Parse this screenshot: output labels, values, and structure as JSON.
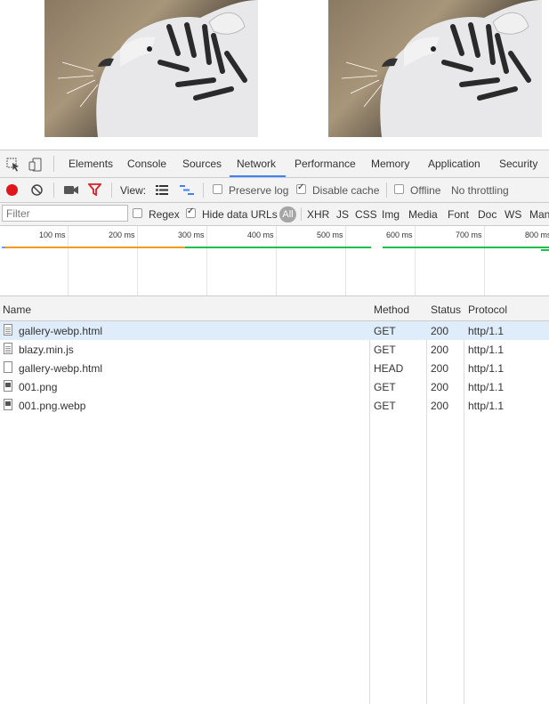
{
  "tabs": [
    "Elements",
    "Console",
    "Sources",
    "Network",
    "Performance",
    "Memory",
    "Application",
    "Security"
  ],
  "active_tab": "Network",
  "toolbar": {
    "view_label": "View:",
    "preserve_log": "Preserve log",
    "preserve_log_checked": false,
    "disable_cache": "Disable cache",
    "disable_cache_checked": true,
    "offline": "Offline",
    "offline_checked": false,
    "throttling": "No throttling"
  },
  "filterbar": {
    "placeholder": "Filter",
    "regex": "Regex",
    "regex_checked": false,
    "hide_data_urls": "Hide data URLs",
    "hide_data_urls_checked": true,
    "all": "All",
    "types": [
      "XHR",
      "JS",
      "CSS",
      "Img",
      "Media",
      "Font",
      "Doc",
      "WS",
      "Man"
    ]
  },
  "timeline": {
    "ticks": [
      "100 ms",
      "200 ms",
      "300 ms",
      "400 ms",
      "500 ms",
      "600 ms",
      "700 ms",
      "800 ms"
    ]
  },
  "table": {
    "headers": {
      "name": "Name",
      "method": "Method",
      "status": "Status",
      "protocol": "Protocol"
    },
    "rows": [
      {
        "name": "gallery-webp.html",
        "method": "GET",
        "status": "200",
        "protocol": "http/1.1",
        "icon": "document-icon"
      },
      {
        "name": "blazy.min.js",
        "method": "GET",
        "status": "200",
        "protocol": "http/1.1",
        "icon": "document-icon"
      },
      {
        "name": "gallery-webp.html",
        "method": "HEAD",
        "status": "200",
        "protocol": "http/1.1",
        "icon": "blank-file-icon"
      },
      {
        "name": "001.png",
        "method": "GET",
        "status": "200",
        "protocol": "http/1.1",
        "icon": "image-file-icon"
      },
      {
        "name": "001.png.webp",
        "method": "GET",
        "status": "200",
        "protocol": "http/1.1",
        "icon": "image-file-icon"
      }
    ]
  },
  "colors": {
    "accent": "#3e82f7",
    "record": "#e0161b",
    "filter": "#d72027",
    "selected_row": "#dfecfa"
  }
}
